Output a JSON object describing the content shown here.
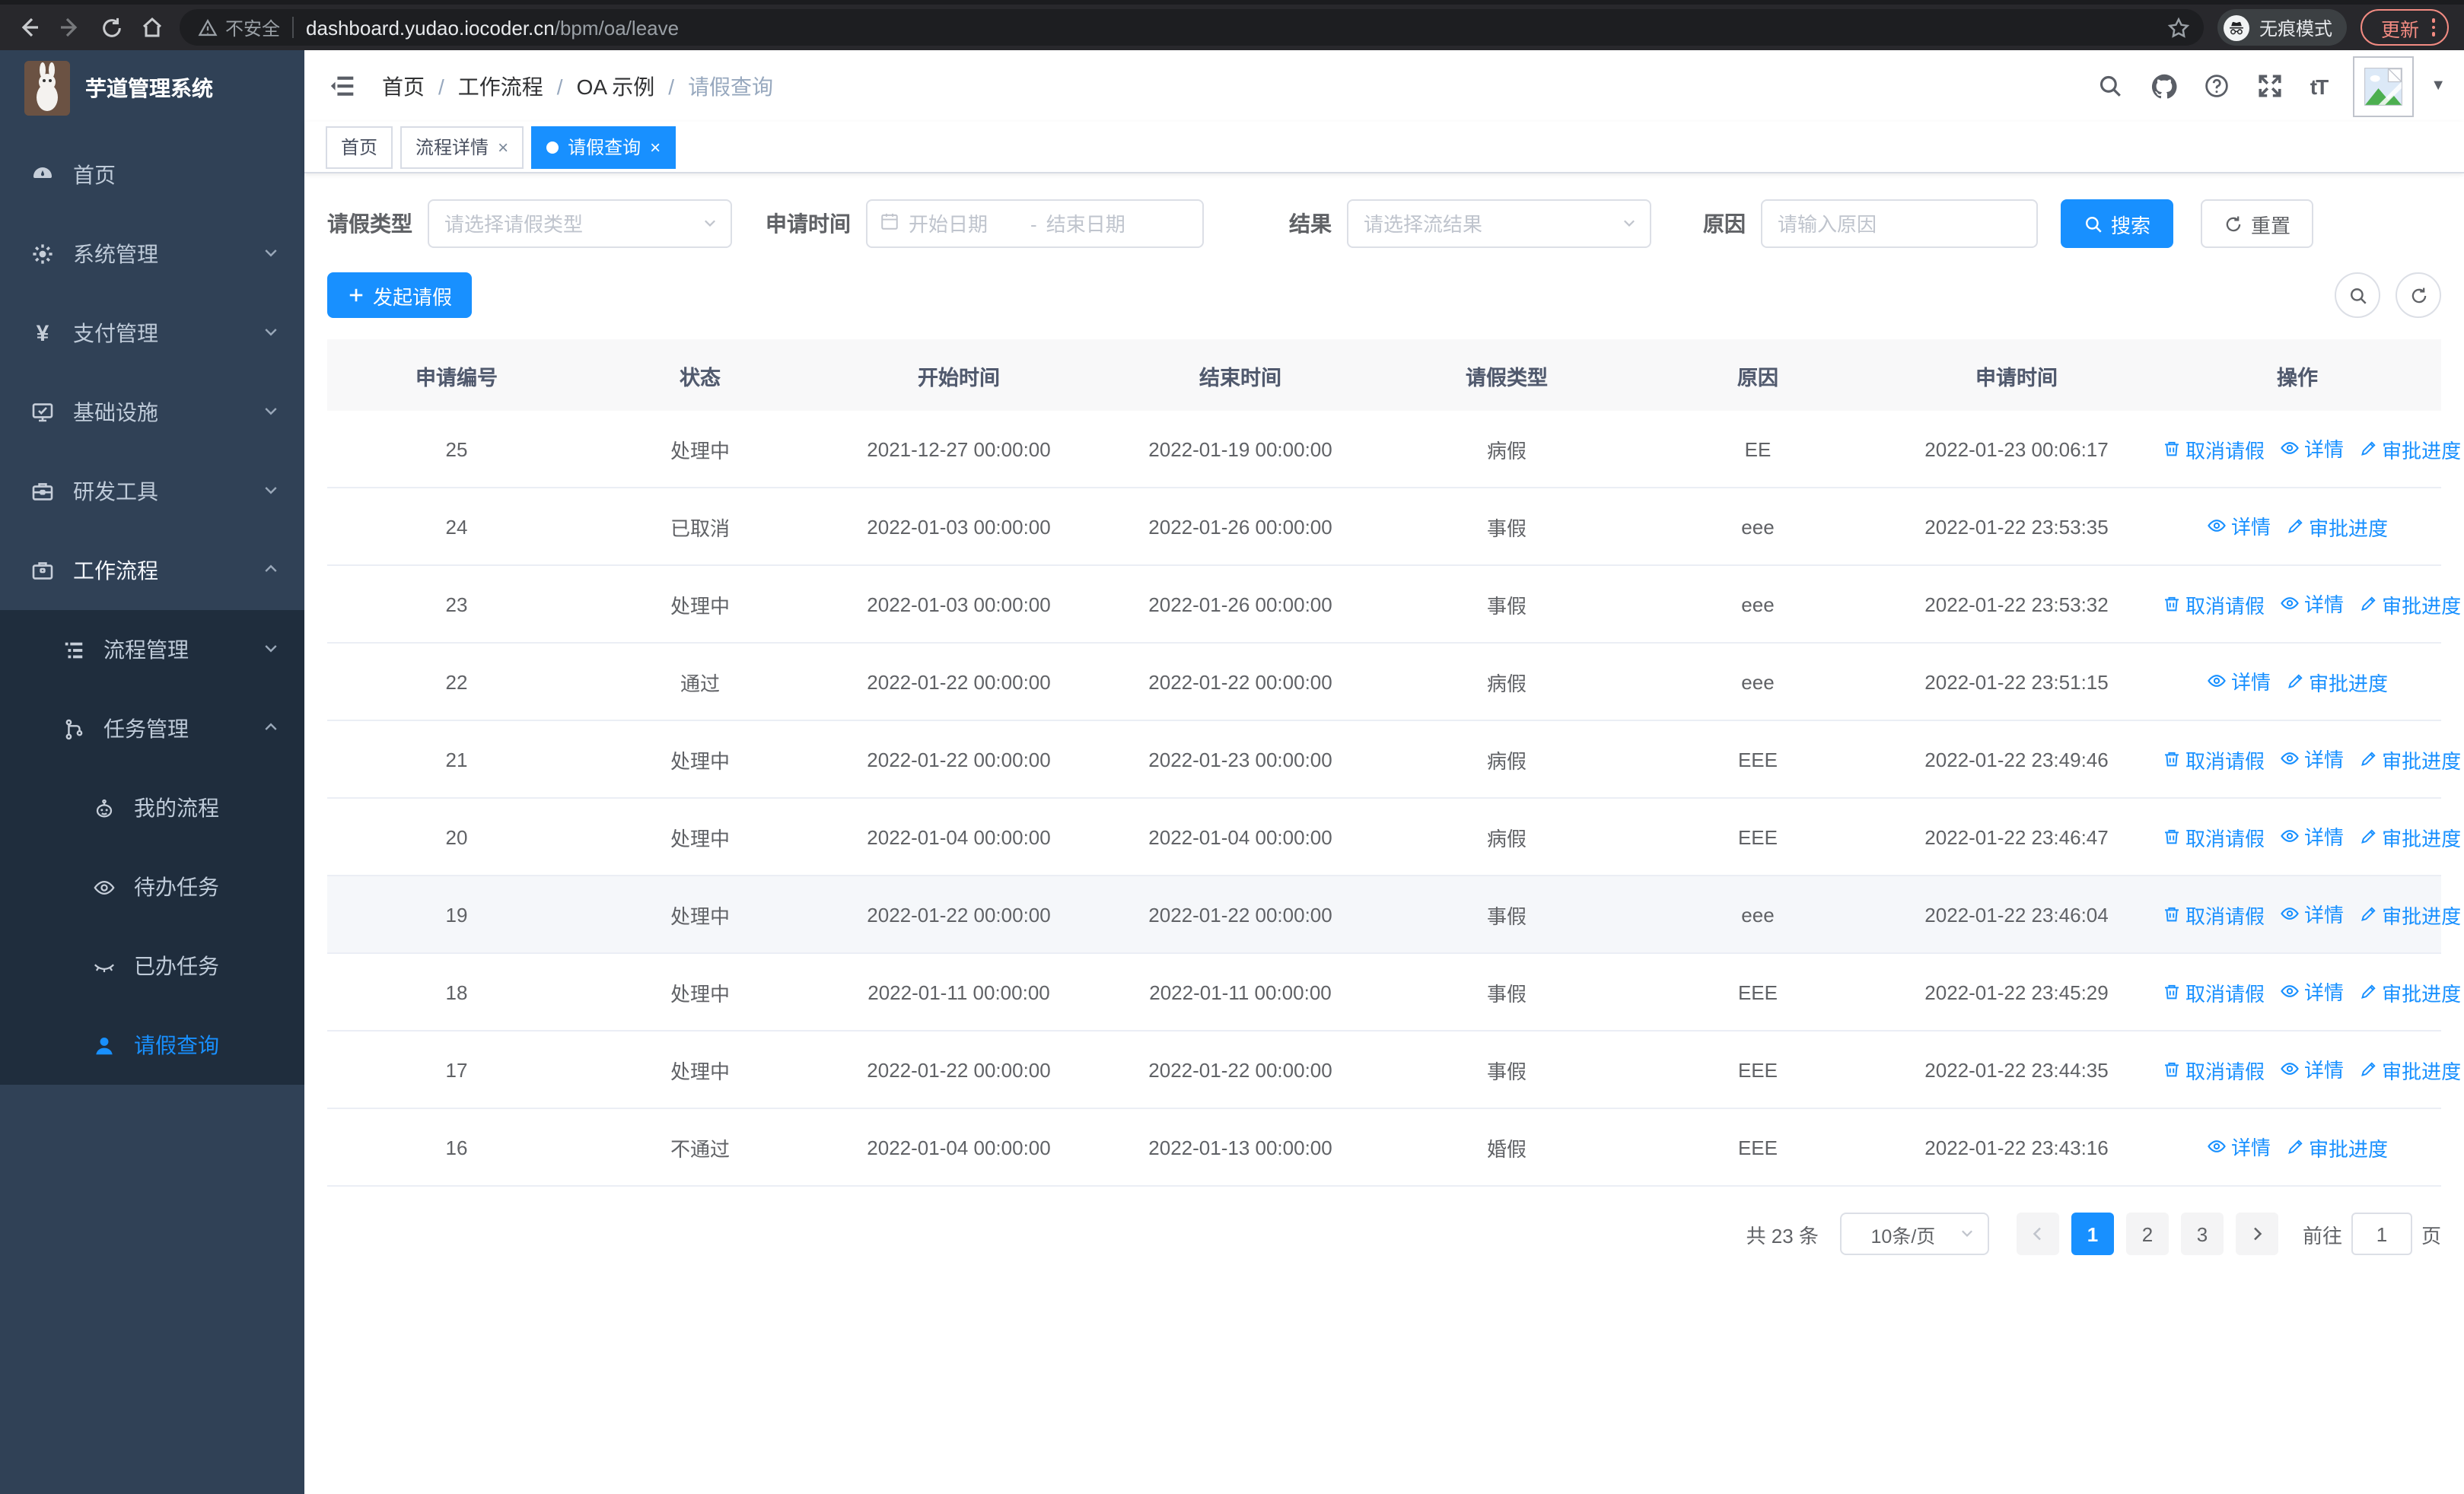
{
  "browser": {
    "security_label": "不安全",
    "url_host": "dashboard.yudao.iocoder.cn",
    "url_path": "/bpm/oa/leave",
    "incognito_label": "无痕模式",
    "update_label": "更新"
  },
  "sidebar": {
    "title": "芋道管理系统",
    "items": [
      {
        "label": "首页"
      },
      {
        "label": "系统管理"
      },
      {
        "label": "支付管理"
      },
      {
        "label": "基础设施"
      },
      {
        "label": "研发工具"
      },
      {
        "label": "工作流程"
      }
    ],
    "workflow_children": [
      {
        "label": "流程管理"
      },
      {
        "label": "任务管理"
      }
    ],
    "task_children": [
      {
        "label": "我的流程"
      },
      {
        "label": "待办任务"
      },
      {
        "label": "已办任务"
      },
      {
        "label": "请假查询"
      }
    ]
  },
  "navbar": {
    "breadcrumb": {
      "item1": "首页",
      "item2": "工作流程",
      "item3": "OA 示例",
      "item4": "请假查询"
    },
    "font_size_label": "tT"
  },
  "tabs": [
    {
      "label": "首页"
    },
    {
      "label": "流程详情"
    },
    {
      "label": "请假查询"
    }
  ],
  "filters": {
    "type_label": "请假类型",
    "type_placeholder": "请选择请假类型",
    "time_label": "申请时间",
    "time_start_placeholder": "开始日期",
    "time_separator": "-",
    "time_end_placeholder": "结束日期",
    "result_label": "结果",
    "result_placeholder": "请选择流结果",
    "reason_label": "原因",
    "reason_placeholder": "请输入原因",
    "search_label": "搜索",
    "reset_label": "重置"
  },
  "toolbar": {
    "create_label": "发起请假"
  },
  "table": {
    "columns": [
      "申请编号",
      "状态",
      "开始时间",
      "结束时间",
      "请假类型",
      "原因",
      "申请时间",
      "操作"
    ],
    "action_labels": {
      "cancel": "取消请假",
      "detail": "详情",
      "progress": "审批进度"
    },
    "rows": [
      {
        "id": "25",
        "status": "处理中",
        "start": "2021-12-27 00:00:00",
        "end": "2022-01-19 00:00:00",
        "type": "病假",
        "reason": "EE",
        "apply_time": "2022-01-23 00:06:17",
        "actions": [
          "cancel",
          "detail",
          "progress"
        ],
        "highlighted": false
      },
      {
        "id": "24",
        "status": "已取消",
        "start": "2022-01-03 00:00:00",
        "end": "2022-01-26 00:00:00",
        "type": "事假",
        "reason": "eee",
        "apply_time": "2022-01-22 23:53:35",
        "actions": [
          "detail",
          "progress"
        ],
        "highlighted": false
      },
      {
        "id": "23",
        "status": "处理中",
        "start": "2022-01-03 00:00:00",
        "end": "2022-01-26 00:00:00",
        "type": "事假",
        "reason": "eee",
        "apply_time": "2022-01-22 23:53:32",
        "actions": [
          "cancel",
          "detail",
          "progress"
        ],
        "highlighted": false
      },
      {
        "id": "22",
        "status": "通过",
        "start": "2022-01-22 00:00:00",
        "end": "2022-01-22 00:00:00",
        "type": "病假",
        "reason": "eee",
        "apply_time": "2022-01-22 23:51:15",
        "actions": [
          "detail",
          "progress"
        ],
        "highlighted": false
      },
      {
        "id": "21",
        "status": "处理中",
        "start": "2022-01-22 00:00:00",
        "end": "2022-01-23 00:00:00",
        "type": "病假",
        "reason": "EEE",
        "apply_time": "2022-01-22 23:49:46",
        "actions": [
          "cancel",
          "detail",
          "progress"
        ],
        "highlighted": false
      },
      {
        "id": "20",
        "status": "处理中",
        "start": "2022-01-04 00:00:00",
        "end": "2022-01-04 00:00:00",
        "type": "病假",
        "reason": "EEE",
        "apply_time": "2022-01-22 23:46:47",
        "actions": [
          "cancel",
          "detail",
          "progress"
        ],
        "highlighted": false
      },
      {
        "id": "19",
        "status": "处理中",
        "start": "2022-01-22 00:00:00",
        "end": "2022-01-22 00:00:00",
        "type": "事假",
        "reason": "eee",
        "apply_time": "2022-01-22 23:46:04",
        "actions": [
          "cancel",
          "detail",
          "progress"
        ],
        "highlighted": true
      },
      {
        "id": "18",
        "status": "处理中",
        "start": "2022-01-11 00:00:00",
        "end": "2022-01-11 00:00:00",
        "type": "事假",
        "reason": "EEE",
        "apply_time": "2022-01-22 23:45:29",
        "actions": [
          "cancel",
          "detail",
          "progress"
        ],
        "highlighted": false
      },
      {
        "id": "17",
        "status": "处理中",
        "start": "2022-01-22 00:00:00",
        "end": "2022-01-22 00:00:00",
        "type": "事假",
        "reason": "EEE",
        "apply_time": "2022-01-22 23:44:35",
        "actions": [
          "cancel",
          "detail",
          "progress"
        ],
        "highlighted": false
      },
      {
        "id": "16",
        "status": "不通过",
        "start": "2022-01-04 00:00:00",
        "end": "2022-01-13 00:00:00",
        "type": "婚假",
        "reason": "EEE",
        "apply_time": "2022-01-22 23:43:16",
        "actions": [
          "detail",
          "progress"
        ],
        "highlighted": false
      }
    ]
  },
  "pagination": {
    "total_label": "共 23 条",
    "page_size_label": "10条/页",
    "pages": [
      "1",
      "2",
      "3"
    ],
    "active_page": "1",
    "goto_label": "前往",
    "goto_value": "1",
    "page_unit_label": "页"
  },
  "colors": {
    "primary": "#1890ff",
    "sidebar_bg": "#304156",
    "submenu_bg": "#1f2d3d"
  }
}
